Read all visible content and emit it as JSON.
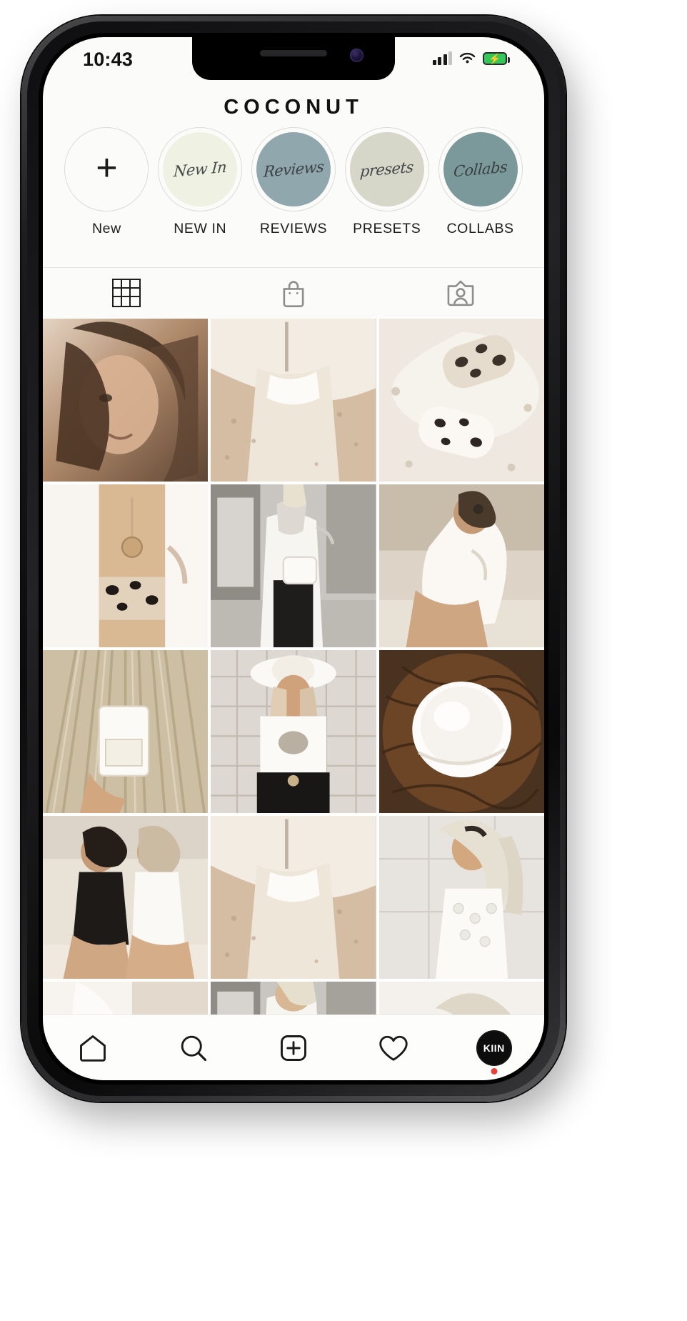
{
  "device": {
    "name": "smartphone-mockup",
    "status_bar": {
      "time": "10:43",
      "signal_icon": "cellular-bars-icon",
      "wifi_icon": "wifi-icon",
      "battery_icon": "battery-charging-icon",
      "battery_color": "#34c759"
    }
  },
  "app": {
    "title": "COCONUT"
  },
  "highlights": [
    {
      "label": "New",
      "bubble_text": "",
      "fill": "#fbfbfa",
      "ring": "#dedbd6",
      "is_add": true,
      "icon": "plus-icon"
    },
    {
      "label": "NEW IN",
      "bubble_text": "New In",
      "fill": "#eff1e2",
      "ring": "#dedbd6",
      "is_add": false,
      "icon": "story-highlight-icon"
    },
    {
      "label": "REVIEWS",
      "bubble_text": "Reviews",
      "fill": "#90a7ad",
      "ring": "#dedbd6",
      "is_add": false,
      "icon": "story-highlight-icon"
    },
    {
      "label": "PRESETS",
      "bubble_text": "presets",
      "fill": "#d6d6c9",
      "ring": "#dedbd6",
      "is_add": false,
      "icon": "story-highlight-icon"
    },
    {
      "label": "COLLABS",
      "bubble_text": "Collabs",
      "fill": "#7b989b",
      "ring": "#dedbd6",
      "is_add": false,
      "icon": "story-highlight-icon"
    }
  ],
  "profile_tabs": [
    {
      "name": "grid",
      "icon": "grid-icon",
      "active": true
    },
    {
      "name": "shop",
      "icon": "shopping-bag-icon",
      "active": false
    },
    {
      "name": "tagged",
      "icon": "tagged-user-icon",
      "active": false
    }
  ],
  "feed": {
    "columns": 3,
    "posts": [
      {
        "alt": "portrait-woman-windblown-hair",
        "c1": "#8a6a52",
        "c2": "#d8c4b0",
        "c3": "#3a2a20",
        "tone": "warm"
      },
      {
        "alt": "snake-print-bikini-sand-detail",
        "c1": "#c9b49f",
        "c2": "#f2ece4",
        "c3": "#9c8872",
        "tone": "light"
      },
      {
        "alt": "leopard-print-flat-shoes",
        "c1": "#efe9e2",
        "c2": "#cbbba6",
        "c3": "#8d7a63",
        "tone": "light"
      },
      {
        "alt": "white-blazer-pendant-necklace",
        "c1": "#e6d7c6",
        "c2": "#cbb49c",
        "c3": "#2c2620",
        "tone": "warm"
      },
      {
        "alt": "street-style-white-coat-purse",
        "c1": "#d9d6d1",
        "c2": "#8f8a84",
        "c3": "#2f2c29",
        "tone": "grey"
      },
      {
        "alt": "woman-satin-robe-sitting-wall",
        "c1": "#ded5c9",
        "c2": "#b49a81",
        "c3": "#6b5a49",
        "tone": "warm"
      },
      {
        "alt": "hand-holding-skincare-palms",
        "c1": "#d6cbb6",
        "c2": "#b8a88e",
        "c3": "#f3efe7",
        "tone": "light"
      },
      {
        "alt": "woman-white-hat-graphic-tee",
        "c1": "#e8e4dd",
        "c2": "#a09789",
        "c3": "#35302a",
        "tone": "grey"
      },
      {
        "alt": "open-coconut-half-closeup",
        "c1": "#6b4a32",
        "c2": "#f6f3ef",
        "c3": "#3a2516",
        "tone": "dark"
      },
      {
        "alt": "two-women-beach-swimwear",
        "c1": "#d9cec0",
        "c2": "#7d6755",
        "c3": "#1c1a18",
        "tone": "warm"
      },
      {
        "alt": "snake-print-bikini-sand-detail",
        "c1": "#c9b49f",
        "c2": "#f2ece4",
        "c3": "#9c8872",
        "tone": "light"
      },
      {
        "alt": "blonde-woman-white-lace-top",
        "c1": "#e9e7e3",
        "c2": "#c9b9a6",
        "c3": "#6d6155",
        "tone": "light"
      },
      {
        "alt": "beach-white-fabric-crop",
        "c1": "#efeae3",
        "c2": "#d3c5b3",
        "c3": "#9b8b78",
        "tone": "light"
      },
      {
        "alt": "street-style-white-coat-crop",
        "c1": "#d9d6d1",
        "c2": "#8f8a84",
        "c3": "#2f2c29",
        "tone": "grey"
      },
      {
        "alt": "woman-sunglasses-white-crop",
        "c1": "#ece9e4",
        "c2": "#bdae9b",
        "c3": "#5d5245",
        "tone": "light"
      }
    ]
  },
  "bottom_nav": [
    {
      "name": "home",
      "icon": "home-icon",
      "label": ""
    },
    {
      "name": "search",
      "icon": "search-icon",
      "label": ""
    },
    {
      "name": "create",
      "icon": "plus-square-icon",
      "label": ""
    },
    {
      "name": "activity",
      "icon": "heart-icon",
      "label": ""
    },
    {
      "name": "profile",
      "icon": "avatar-icon",
      "label": "KIIN",
      "has_badge": true,
      "badge_color": "#e8413a"
    }
  ]
}
